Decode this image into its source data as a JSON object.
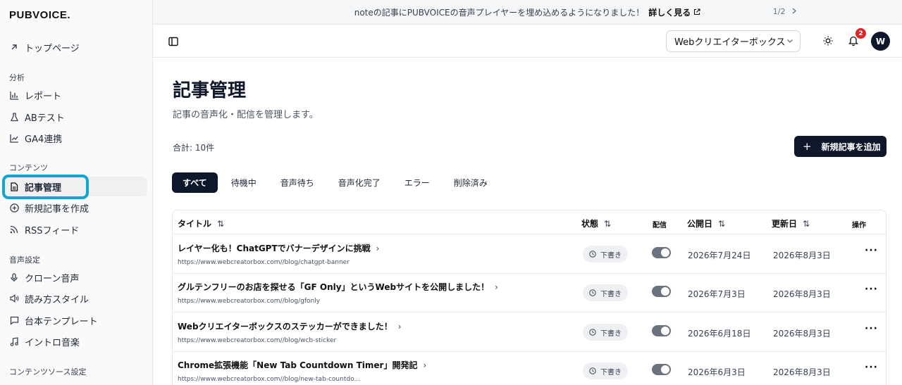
{
  "sidebar": {
    "logo": "PUBVOICE.",
    "top_item": "トップページ",
    "sections": [
      {
        "label": "分析",
        "items": [
          "レポート",
          "ABテスト",
          "GA4連携"
        ]
      },
      {
        "label": "コンテンツ",
        "items": [
          "記事管理",
          "新規記事を作成",
          "RSSフィード"
        ]
      },
      {
        "label": "音声設定",
        "items": [
          "クローン音声",
          "読み方スタイル",
          "台本テンプレート",
          "イントロ音楽"
        ]
      },
      {
        "label": "コンテンツソース設定",
        "items": []
      }
    ],
    "active_item": "記事管理"
  },
  "banner": {
    "message": "noteの記事にPUBVOICEの音声プレイヤーを埋め込めるようになりました！",
    "more": "詳しく見る",
    "pager": "1/2"
  },
  "header": {
    "site_select": "Webクリエイターボックス",
    "notification_count": "2",
    "avatar_initial": "W"
  },
  "main": {
    "title": "記事管理",
    "subtitle": "記事の音声化・配信を管理します。",
    "total": "合計: 10件",
    "add_button": "新規記事を追加",
    "tabs": [
      "すべて",
      "待機中",
      "音声待ち",
      "音声化完了",
      "エラー",
      "削除済み"
    ],
    "active_tab": "すべて"
  },
  "table": {
    "headers": {
      "title": "タイトル",
      "status": "状態",
      "distribution": "配信",
      "published": "公開日",
      "updated": "更新日",
      "actions": "操作"
    },
    "rows": [
      {
        "title": "レイヤー化も！ChatGPTでバナーデザインに挑戦",
        "url": "https://www.webcreatorbox.com//blog/chatgpt-banner",
        "status": "下書き",
        "published": "2026年7月24日",
        "updated": "2026年8月3日",
        "distribution_on": true
      },
      {
        "title": "グルテンフリーのお店を探せる「GF Only」というWebサイトを公開しました！",
        "url": "https://www.webcreatorbox.com//blog/gfonly",
        "status": "下書き",
        "published": "2026年7月3日",
        "updated": "2026年8月3日",
        "distribution_on": true
      },
      {
        "title": "Webクリエイターボックスのステッカーができました！",
        "url": "https://www.webcreatorbox.com//blog/wcb-sticker",
        "status": "下書き",
        "published": "2026年6月18日",
        "updated": "2026年8月3日",
        "distribution_on": true
      },
      {
        "title": "Chrome拡張機能「New Tab Countdown Timer」開発記",
        "url": "https://www.webcreatorbox.com//blog/new-tab-countdo...",
        "status": "下書き",
        "published": "2026年6月3日",
        "updated": "2026年8月3日",
        "distribution_on": true
      }
    ]
  }
}
